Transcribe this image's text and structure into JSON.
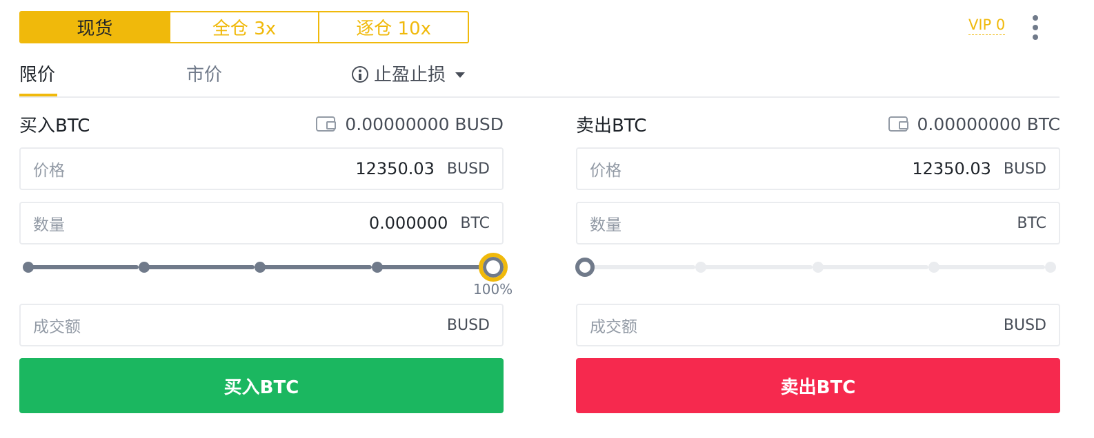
{
  "mode_tabs": [
    "现货",
    "全仓 3x",
    "逐仓 10x"
  ],
  "vip_label": "VIP 0",
  "order_tabs": {
    "limit": "限价",
    "market": "市价",
    "tpsl": "止盈止损"
  },
  "buy": {
    "title": "买入BTC",
    "balance": "0.00000000 BUSD",
    "price": {
      "label": "价格",
      "value": "12350.03",
      "unit": "BUSD"
    },
    "amount": {
      "label": "数量",
      "value": "0.000000",
      "unit": "BTC"
    },
    "slider": {
      "percent": 100,
      "label": "100%"
    },
    "total": {
      "label": "成交额",
      "unit": "BUSD"
    },
    "button": "买入BTC"
  },
  "sell": {
    "title": "卖出BTC",
    "balance": "0.00000000 BTC",
    "price": {
      "label": "价格",
      "value": "12350.03",
      "unit": "BUSD"
    },
    "amount": {
      "label": "数量",
      "unit": "BTC"
    },
    "slider": {
      "percent": 0
    },
    "total": {
      "label": "成交额",
      "unit": "BUSD"
    },
    "button": "卖出BTC"
  },
  "colors": {
    "accent": "#f0b90b",
    "buy": "#1bb760",
    "sell": "#f6294e",
    "track_active": "#707a8a",
    "track_inactive": "#eaecef"
  }
}
